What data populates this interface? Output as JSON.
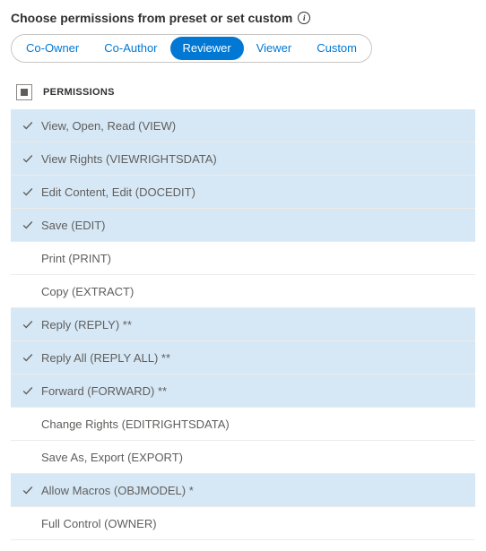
{
  "heading": "Choose permissions from preset or set custom",
  "presets": [
    {
      "label": "Co-Owner",
      "selected": false
    },
    {
      "label": "Co-Author",
      "selected": false
    },
    {
      "label": "Reviewer",
      "selected": true
    },
    {
      "label": "Viewer",
      "selected": false
    },
    {
      "label": "Custom",
      "selected": false
    }
  ],
  "columns": {
    "permissions": "PERMISSIONS"
  },
  "permissions": [
    {
      "label": "View, Open, Read (VIEW)",
      "checked": true
    },
    {
      "label": "View Rights (VIEWRIGHTSDATA)",
      "checked": true
    },
    {
      "label": "Edit Content, Edit (DOCEDIT)",
      "checked": true
    },
    {
      "label": "Save (EDIT)",
      "checked": true
    },
    {
      "label": "Print (PRINT)",
      "checked": false
    },
    {
      "label": "Copy (EXTRACT)",
      "checked": false
    },
    {
      "label": "Reply (REPLY) **",
      "checked": true
    },
    {
      "label": "Reply All (REPLY ALL) **",
      "checked": true
    },
    {
      "label": "Forward (FORWARD) **",
      "checked": true
    },
    {
      "label": "Change Rights (EDITRIGHTSDATA)",
      "checked": false
    },
    {
      "label": "Save As, Export (EXPORT)",
      "checked": false
    },
    {
      "label": "Allow Macros (OBJMODEL) *",
      "checked": true
    },
    {
      "label": "Full Control (OWNER)",
      "checked": false
    }
  ]
}
